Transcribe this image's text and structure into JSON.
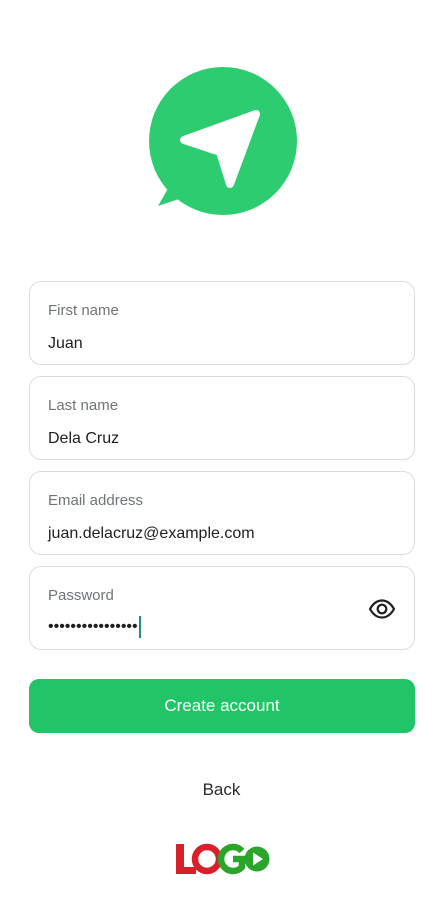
{
  "form": {
    "first_name": {
      "label": "First name",
      "value": "Juan"
    },
    "last_name": {
      "label": "Last name",
      "value": "Dela Cruz"
    },
    "email": {
      "label": "Email address",
      "value": "juan.delacruz@example.com"
    },
    "password": {
      "label": "Password",
      "masked_value": "••••••••••••••••"
    }
  },
  "actions": {
    "create_account_label": "Create account",
    "back_label": "Back"
  },
  "branding": {
    "logo_text": "LOGO",
    "app_icon": "send-chat-icon",
    "accent_color": "#21c467",
    "logo_red": "#d8202a",
    "logo_green": "#2aa52a"
  }
}
